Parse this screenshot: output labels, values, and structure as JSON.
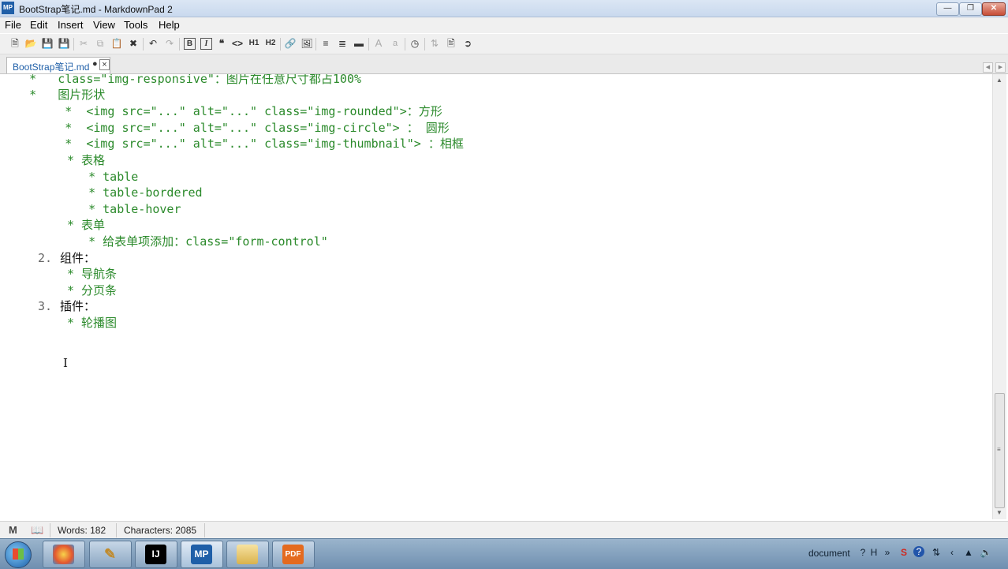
{
  "window": {
    "title": "BootStrap笔记.md - MarkdownPad 2",
    "app_icon": "MP"
  },
  "menu": [
    "File",
    "Edit",
    "Insert",
    "View",
    "Tools",
    "Help"
  ],
  "toolbar": {
    "bold": "B",
    "italic": "I",
    "quote": "❝",
    "code": "<>",
    "h1": "H1",
    "h2": "H2",
    "font_up": "A",
    "font_down": "a"
  },
  "tab": {
    "label": "BootStrap笔记.md",
    "modified": "●",
    "close": "×"
  },
  "editor_lines": [
    "   *   class=\"img-responsive\"：图片在任意尺寸都占100%",
    "   *   图片形状",
    "        *  <img src=\"...\" alt=\"...\" class=\"img-rounded\">：方形",
    "        *  <img src=\"...\" alt=\"...\" class=\"img-circle\"> ： 圆形",
    "        *  <img src=\"...\" alt=\"...\" class=\"img-thumbnail\"> ：相框",
    "* 表格",
    "   * table",
    "   * table-bordered",
    "   * table-hover",
    "* 表单",
    "   * 给表单项添加：class=\"form-control\"",
    "2.",
    "组件：",
    "* 导航条",
    "* 分页条",
    "3.",
    "插件：",
    "* 轮播图"
  ],
  "status": {
    "words_label": "Words: 182",
    "chars_label": "Characters: 2085"
  },
  "taskbar": {
    "apps": [
      "MP",
      "PDF"
    ],
    "tray_text": "document",
    "ime": "H"
  },
  "colors": {
    "markdown_list": "#2b8a2b",
    "heading_text": "#111111",
    "accent": "#1f5fa8"
  }
}
